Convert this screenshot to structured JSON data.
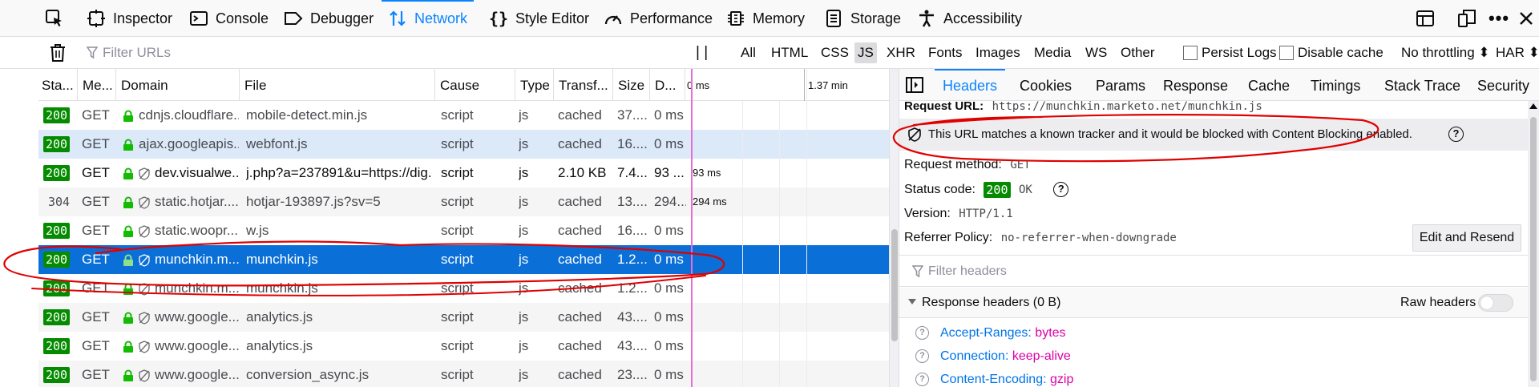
{
  "toolbar": {
    "tools": [
      {
        "label": "",
        "icon": "pick-element-icon"
      },
      {
        "label": "Inspector",
        "icon": "inspector-icon"
      },
      {
        "label": "Console",
        "icon": "console-icon"
      },
      {
        "label": "Debugger",
        "icon": "debugger-icon"
      },
      {
        "label": "Network",
        "icon": "network-icon",
        "selected": true
      },
      {
        "label": "Style Editor",
        "icon": "style-editor-icon"
      },
      {
        "label": "Performance",
        "icon": "performance-icon"
      },
      {
        "label": "Memory",
        "icon": "memory-icon"
      },
      {
        "label": "Storage",
        "icon": "storage-icon"
      },
      {
        "label": "Accessibility",
        "icon": "accessibility-icon"
      }
    ],
    "right_icons": [
      "dock-side-icon",
      "responsive-icon",
      "more-icon",
      "close-icon"
    ]
  },
  "filterbar": {
    "filter_placeholder": "Filter URLs",
    "pause_label": "| |",
    "types": [
      "All",
      "HTML",
      "CSS",
      "JS",
      "XHR",
      "Fonts",
      "Images",
      "Media",
      "WS",
      "Other"
    ],
    "selected_type": "JS",
    "persist_logs": "Persist Logs",
    "disable_cache": "Disable cache",
    "throttling": "No throttling ⬍",
    "har": "HAR ⬍"
  },
  "table": {
    "columns": [
      "Sta...",
      "Me...",
      "Domain",
      "File",
      "Cause",
      "Type",
      "Transf...",
      "Size",
      "D...",
      "0 ms",
      "1.37 min"
    ],
    "rows": [
      {
        "status": "200",
        "method": "GET",
        "domain": "cdnjs.cloudflare....",
        "tracker": false,
        "file": "mobile-detect.min.js",
        "cause": "script",
        "type": "js",
        "transferred": "cached",
        "size": "37....",
        "duration": "0 ms",
        "timing": ""
      },
      {
        "status": "200",
        "method": "GET",
        "domain": "ajax.googleapis....",
        "tracker": false,
        "file": "webfont.js",
        "cause": "script",
        "type": "js",
        "transferred": "cached",
        "size": "16....",
        "duration": "0 ms",
        "timing": "",
        "state": "hover"
      },
      {
        "status": "200",
        "method": "GET",
        "domain": "dev.visualwe...",
        "tracker": true,
        "file": "j.php?a=237891&u=https://dig...",
        "cause": "script",
        "type": "js",
        "transferred": "2.10 KB",
        "size": "7.4...",
        "duration": "93 ...",
        "timing": "93 ms",
        "dark": true
      },
      {
        "status": "304",
        "method": "GET",
        "domain": "static.hotjar....",
        "tracker": true,
        "file": "hotjar-193897.js?sv=5",
        "cause": "script",
        "type": "js",
        "transferred": "cached",
        "size": "13....",
        "duration": "294...",
        "timing": "294 ms"
      },
      {
        "status": "200",
        "method": "GET",
        "domain": "static.woopr....",
        "tracker": true,
        "file": "w.js",
        "cause": "script",
        "type": "js",
        "transferred": "cached",
        "size": "16....",
        "duration": "0 ms",
        "timing": ""
      },
      {
        "status": "200",
        "method": "GET",
        "domain": "munchkin.m...",
        "tracker": true,
        "file": "munchkin.js",
        "cause": "script",
        "type": "js",
        "transferred": "cached",
        "size": "1.2...",
        "duration": "0 ms",
        "timing": "",
        "state": "selected"
      },
      {
        "status": "200",
        "method": "GET",
        "domain": "munchkin.m...",
        "tracker": true,
        "file": "munchkin.js",
        "cause": "script",
        "type": "js",
        "transferred": "cached",
        "size": "1.2...",
        "duration": "0 ms",
        "timing": ""
      },
      {
        "status": "200",
        "method": "GET",
        "domain": "www.google...",
        "tracker": true,
        "file": "analytics.js",
        "cause": "script",
        "type": "js",
        "transferred": "cached",
        "size": "43....",
        "duration": "0 ms",
        "timing": ""
      },
      {
        "status": "200",
        "method": "GET",
        "domain": "www.google...",
        "tracker": true,
        "file": "analytics.js",
        "cause": "script",
        "type": "js",
        "transferred": "cached",
        "size": "43....",
        "duration": "0 ms",
        "timing": ""
      },
      {
        "status": "200",
        "method": "GET",
        "domain": "www.google...",
        "tracker": true,
        "file": "conversion_async.js",
        "cause": "script",
        "type": "js",
        "transferred": "cached",
        "size": "23....",
        "duration": "0 ms",
        "timing": ""
      }
    ]
  },
  "details": {
    "tabs": [
      "Headers",
      "Cookies",
      "Params",
      "Response",
      "Cache",
      "Timings",
      "Stack Trace",
      "Security"
    ],
    "selected_tab": "Headers",
    "request_url_label": "Request URL:",
    "request_url": "https://munchkin.marketo.net/munchkin.js",
    "tracker_note": "This URL matches a known tracker and it would be blocked with Content Blocking enabled.",
    "request_method_label": "Request method:",
    "request_method": "GET",
    "status_code_label": "Status code:",
    "status_code": "200",
    "status_text": "OK",
    "version_label": "Version:",
    "version": "HTTP/1.1",
    "referrer_label": "Referrer Policy:",
    "referrer": "no-referrer-when-downgrade",
    "edit_resend": "Edit and Resend",
    "filter_headers_placeholder": "Filter headers",
    "response_headers_label": "Response headers (0 B)",
    "raw_headers_label": "Raw headers",
    "response_headers": [
      {
        "name": "Accept-Ranges:",
        "value": "bytes"
      },
      {
        "name": "Connection:",
        "value": "keep-alive"
      },
      {
        "name": "Content-Encoding:",
        "value": "gzip"
      }
    ]
  },
  "colors": {
    "accent": "#0a84ff",
    "selected_row": "#0a6fd6",
    "status_ok": "#058b00",
    "annotation": "#e00000",
    "timeline_marker": "#e46fd6"
  }
}
